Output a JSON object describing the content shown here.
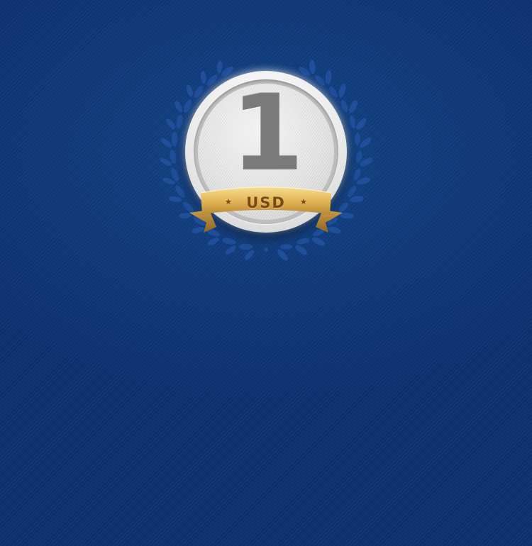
{
  "badge": {
    "value": "1",
    "currency": "USD",
    "star_glyph": "★"
  },
  "colors": {
    "background": "#10397a",
    "wreath": "#1f4f9a",
    "coin": "#e8e8e8",
    "numeral": "#7a7a7a",
    "ribbon": "#e0b554",
    "ribbon_text": "#7a4a16"
  },
  "icons": {
    "wreath": "laurel-wreath-icon",
    "star": "star-icon"
  }
}
